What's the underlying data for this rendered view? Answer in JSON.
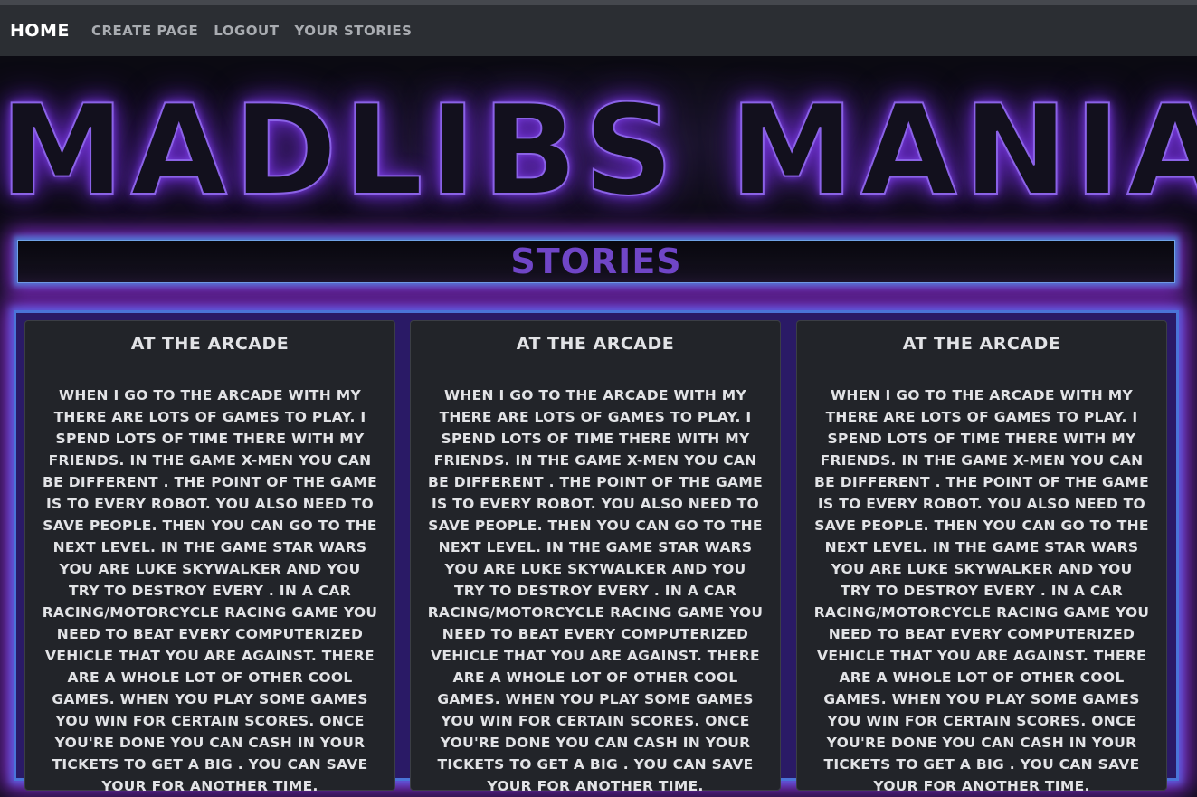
{
  "nav": {
    "home": "HOME",
    "links": [
      "CREATE PAGE",
      "LOGOUT",
      "YOUR STORIES"
    ]
  },
  "hero": {
    "title": "MADLIBS MANIA"
  },
  "section": {
    "title": "STORIES"
  },
  "colors": {
    "neon_purple": "#8a62e6",
    "neon_blue": "#4a74d8",
    "panel_bg": "#2a1a66",
    "card_bg": "#222429",
    "stories_title": "#7046c7"
  },
  "stories": [
    {
      "title": "AT THE ARCADE",
      "text": "WHEN I GO TO THE ARCADE WITH MY THERE ARE LOTS OF GAMES TO PLAY. I SPEND LOTS OF TIME THERE WITH MY FRIENDS. IN THE GAME X-MEN YOU CAN BE DIFFERENT . THE POINT OF THE GAME IS TO EVERY ROBOT. YOU ALSO NEED TO SAVE PEOPLE. THEN YOU CAN GO TO THE NEXT LEVEL. IN THE GAME STAR WARS YOU ARE LUKE SKYWALKER AND YOU TRY TO DESTROY EVERY . IN A CAR RACING/MOTORCYCLE RACING GAME YOU NEED TO BEAT EVERY COMPUTERIZED VEHICLE THAT YOU ARE AGAINST. THERE ARE A WHOLE LOT OF OTHER COOL GAMES. WHEN YOU PLAY SOME GAMES YOU WIN FOR CERTAIN SCORES. ONCE YOU'RE DONE YOU CAN CASH IN YOUR TICKETS TO GET A BIG . YOU CAN SAVE YOUR FOR ANOTHER TIME."
    },
    {
      "title": "AT THE ARCADE",
      "text": "WHEN I GO TO THE ARCADE WITH MY THERE ARE LOTS OF GAMES TO PLAY. I SPEND LOTS OF TIME THERE WITH MY FRIENDS. IN THE GAME X-MEN YOU CAN BE DIFFERENT . THE POINT OF THE GAME IS TO EVERY ROBOT. YOU ALSO NEED TO SAVE PEOPLE. THEN YOU CAN GO TO THE NEXT LEVEL. IN THE GAME STAR WARS YOU ARE LUKE SKYWALKER AND YOU TRY TO DESTROY EVERY . IN A CAR RACING/MOTORCYCLE RACING GAME YOU NEED TO BEAT EVERY COMPUTERIZED VEHICLE THAT YOU ARE AGAINST. THERE ARE A WHOLE LOT OF OTHER COOL GAMES. WHEN YOU PLAY SOME GAMES YOU WIN FOR CERTAIN SCORES. ONCE YOU'RE DONE YOU CAN CASH IN YOUR TICKETS TO GET A BIG . YOU CAN SAVE YOUR FOR ANOTHER TIME."
    },
    {
      "title": "AT THE ARCADE",
      "text": "WHEN I GO TO THE ARCADE WITH MY THERE ARE LOTS OF GAMES TO PLAY. I SPEND LOTS OF TIME THERE WITH MY FRIENDS. IN THE GAME X-MEN YOU CAN BE DIFFERENT . THE POINT OF THE GAME IS TO EVERY ROBOT. YOU ALSO NEED TO SAVE PEOPLE. THEN YOU CAN GO TO THE NEXT LEVEL. IN THE GAME STAR WARS YOU ARE LUKE SKYWALKER AND YOU TRY TO DESTROY EVERY . IN A CAR RACING/MOTORCYCLE RACING GAME YOU NEED TO BEAT EVERY COMPUTERIZED VEHICLE THAT YOU ARE AGAINST. THERE ARE A WHOLE LOT OF OTHER COOL GAMES. WHEN YOU PLAY SOME GAMES YOU WIN FOR CERTAIN SCORES. ONCE YOU'RE DONE YOU CAN CASH IN YOUR TICKETS TO GET A BIG . YOU CAN SAVE YOUR FOR ANOTHER TIME."
    }
  ]
}
